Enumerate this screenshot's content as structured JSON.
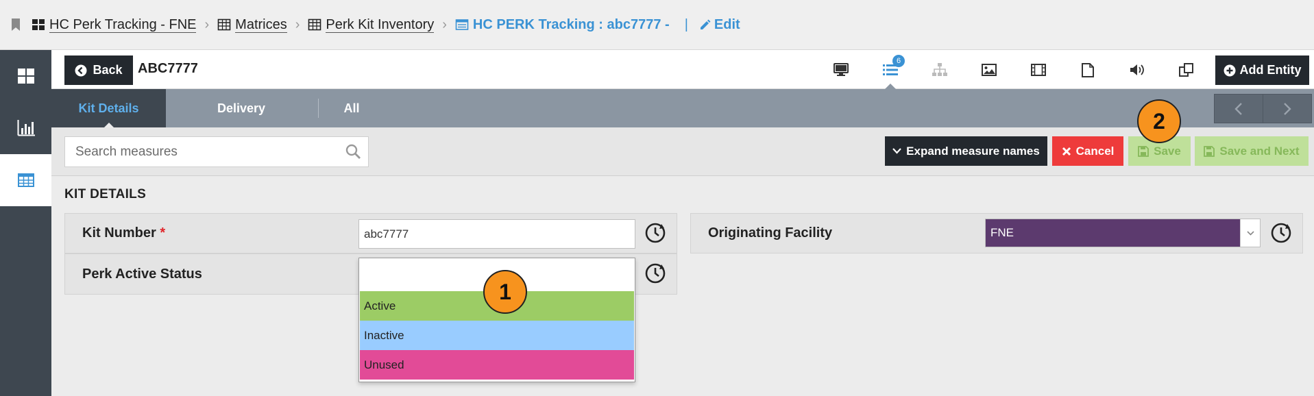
{
  "breadcrumb": {
    "items": [
      "HC Perk Tracking - FNE",
      "Matrices",
      "Perk Kit Inventory"
    ],
    "active": "HC PERK Tracking : abc7777  -",
    "edit_label": "Edit"
  },
  "header": {
    "back_label": "Back",
    "entity_title": "ABC7777",
    "badge_count": "6",
    "add_entity_label": "Add Entity",
    "tool_icons": [
      "monitor-icon",
      "list-icon",
      "hierarchy-icon",
      "image-icon",
      "film-icon",
      "document-icon",
      "speaker-icon",
      "copy-icon"
    ]
  },
  "tabs": {
    "items": [
      "Kit Details",
      "Delivery",
      "All"
    ],
    "active": "Kit Details"
  },
  "toolbar": {
    "search_placeholder": "Search measures",
    "expand_label": "Expand measure names",
    "cancel_label": "Cancel",
    "save_label": "Save",
    "save_next_label": "Save and Next"
  },
  "section": {
    "title": "KIT DETAILS",
    "kit_number_label": "Kit Number",
    "required_mark": "*",
    "kit_number_value": "abc7777",
    "perk_status_label": "Perk Active Status",
    "facility_label": "Originating Facility",
    "facility_value": "FNE"
  },
  "dropdown": {
    "options": [
      "Active",
      "Inactive",
      "Unused"
    ],
    "colors": [
      "#9ccc65",
      "#99ccff",
      "#e24b97"
    ]
  },
  "callouts": [
    "1",
    "2"
  ],
  "colors": {
    "accent": "#3a92d4",
    "dark": "#23282e",
    "rail": "#3e4750",
    "cancel": "#ee3b3b",
    "save_disabled": "#bfe09a",
    "facility_bg": "#5c3a6e",
    "callout": "#f7931e"
  }
}
